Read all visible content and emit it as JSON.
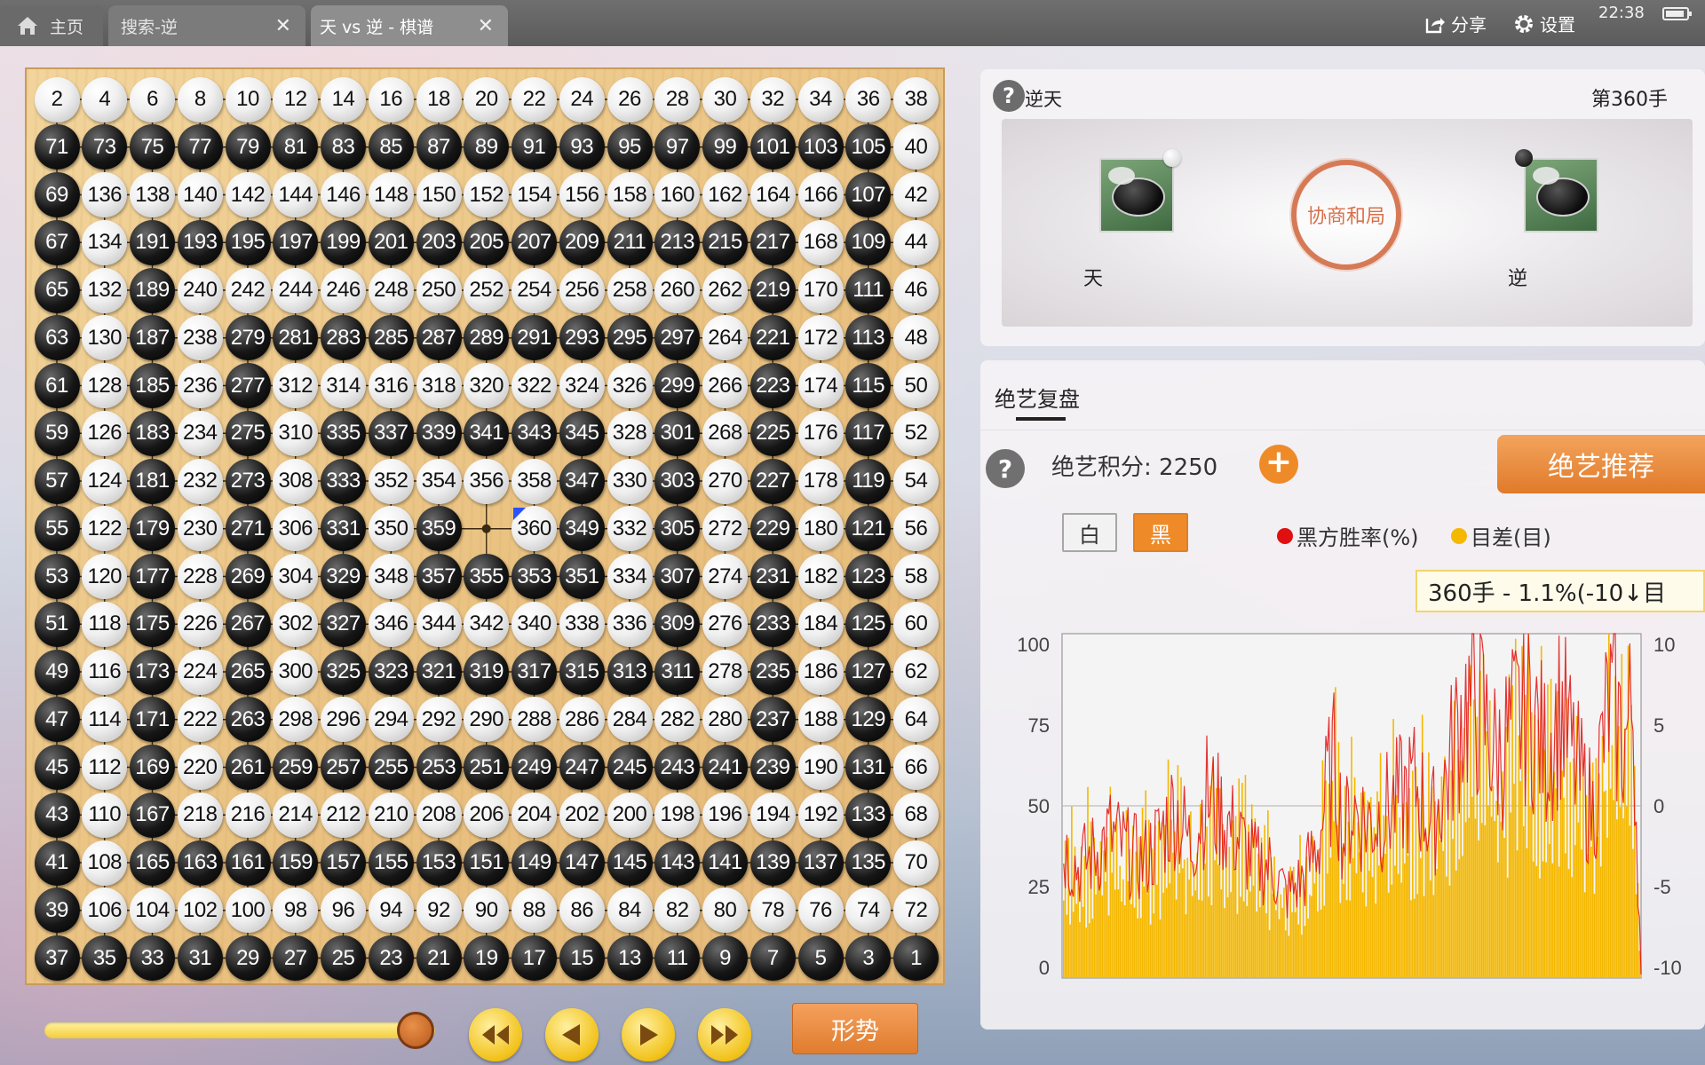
{
  "tabs": [
    {
      "label": "主页"
    },
    {
      "label": "搜索-逆"
    },
    {
      "label": "天 vs 逆 - 棋谱"
    }
  ],
  "toolbar": {
    "share": "分享",
    "settings": "设置"
  },
  "status": {
    "time": "22:38"
  },
  "game": {
    "rule": "逆天",
    "move_no": "第360手",
    "result_seal": "协商和局",
    "players": {
      "white": "天",
      "black": "逆"
    },
    "last_move": 360,
    "board": [
      [
        2,
        4,
        6,
        8,
        10,
        12,
        14,
        16,
        18,
        20,
        22,
        24,
        26,
        28,
        30,
        32,
        34,
        36,
        38
      ],
      [
        71,
        73,
        75,
        77,
        79,
        81,
        83,
        85,
        87,
        89,
        91,
        93,
        95,
        97,
        99,
        101,
        103,
        105,
        40
      ],
      [
        69,
        136,
        138,
        140,
        142,
        144,
        146,
        148,
        150,
        152,
        154,
        156,
        158,
        160,
        162,
        164,
        166,
        107,
        42
      ],
      [
        67,
        134,
        191,
        193,
        195,
        197,
        199,
        201,
        203,
        205,
        207,
        209,
        211,
        213,
        215,
        217,
        168,
        109,
        44
      ],
      [
        65,
        132,
        189,
        240,
        242,
        244,
        246,
        248,
        250,
        252,
        254,
        256,
        258,
        260,
        262,
        219,
        170,
        111,
        46
      ],
      [
        63,
        130,
        187,
        238,
        279,
        281,
        283,
        285,
        287,
        289,
        291,
        293,
        295,
        297,
        264,
        221,
        172,
        113,
        48
      ],
      [
        61,
        128,
        185,
        236,
        277,
        312,
        314,
        316,
        318,
        320,
        322,
        324,
        326,
        299,
        266,
        223,
        174,
        115,
        50
      ],
      [
        59,
        126,
        183,
        234,
        275,
        310,
        335,
        337,
        339,
        341,
        343,
        345,
        328,
        301,
        268,
        225,
        176,
        117,
        52
      ],
      [
        57,
        124,
        181,
        232,
        273,
        308,
        333,
        352,
        354,
        356,
        358,
        347,
        330,
        303,
        270,
        227,
        178,
        119,
        54
      ],
      [
        55,
        122,
        179,
        230,
        271,
        306,
        331,
        350,
        359,
        null,
        360,
        349,
        332,
        305,
        272,
        229,
        180,
        121,
        56
      ],
      [
        53,
        120,
        177,
        228,
        269,
        304,
        329,
        348,
        357,
        355,
        353,
        351,
        334,
        307,
        274,
        231,
        182,
        123,
        58
      ],
      [
        51,
        118,
        175,
        226,
        267,
        302,
        327,
        346,
        344,
        342,
        340,
        338,
        336,
        309,
        276,
        233,
        184,
        125,
        60
      ],
      [
        49,
        116,
        173,
        224,
        265,
        300,
        325,
        323,
        321,
        319,
        317,
        315,
        313,
        311,
        278,
        235,
        186,
        127,
        62
      ],
      [
        47,
        114,
        171,
        222,
        263,
        298,
        296,
        294,
        292,
        290,
        288,
        286,
        284,
        282,
        280,
        237,
        188,
        129,
        64
      ],
      [
        45,
        112,
        169,
        220,
        261,
        259,
        257,
        255,
        253,
        251,
        249,
        247,
        245,
        243,
        241,
        239,
        190,
        131,
        66
      ],
      [
        43,
        110,
        167,
        218,
        216,
        214,
        212,
        210,
        208,
        206,
        204,
        202,
        200,
        198,
        196,
        194,
        192,
        133,
        68
      ],
      [
        41,
        108,
        165,
        163,
        161,
        159,
        157,
        155,
        153,
        151,
        149,
        147,
        145,
        143,
        141,
        139,
        137,
        135,
        70
      ],
      [
        39,
        106,
        104,
        102,
        100,
        98,
        96,
        94,
        92,
        90,
        88,
        86,
        84,
        82,
        80,
        78,
        76,
        74,
        72
      ],
      [
        37,
        35,
        33,
        31,
        29,
        27,
        25,
        23,
        21,
        19,
        17,
        15,
        13,
        11,
        9,
        7,
        5,
        3,
        1
      ]
    ]
  },
  "controls": {
    "position_label": "形势",
    "slider_progress": 0.95
  },
  "review": {
    "tab_label": "绝艺复盘",
    "score_label": "绝艺积分: 2250",
    "recommend_label": "绝艺推荐",
    "side_white": "白",
    "side_black": "黑",
    "legend_winrate": "黑方胜率(%)",
    "legend_diff": "目差(目)",
    "tooltip": "360手 - 1.1%(-10↓目"
  },
  "colors": {
    "accent": "#ef8a28",
    "winrate": "#e01010",
    "diff": "#f5b800"
  },
  "chart_data": {
    "type": "line",
    "moves": 360,
    "left_axis": {
      "ticks": [
        "100",
        "75",
        "50",
        "25",
        "0"
      ],
      "range": [
        0,
        100
      ]
    },
    "right_axis": {
      "ticks": [
        "10",
        "5",
        "0",
        "-5",
        "-10"
      ],
      "range": [
        -10,
        10
      ]
    },
    "series": [
      {
        "name": "黑方胜率(%)",
        "color": "#e01010"
      },
      {
        "name": "目差(目)",
        "color": "#f5b800"
      }
    ],
    "envelope": [
      [
        0,
        48
      ],
      [
        10,
        40
      ],
      [
        20,
        45
      ],
      [
        30,
        52
      ],
      [
        40,
        46
      ],
      [
        50,
        42
      ],
      [
        60,
        50
      ],
      [
        70,
        62
      ],
      [
        80,
        48
      ],
      [
        90,
        66
      ],
      [
        100,
        58
      ],
      [
        110,
        50
      ],
      [
        120,
        42
      ],
      [
        130,
        40
      ],
      [
        140,
        30
      ],
      [
        150,
        36
      ],
      [
        160,
        50
      ],
      [
        165,
        70
      ],
      [
        170,
        78
      ],
      [
        175,
        50
      ],
      [
        180,
        62
      ],
      [
        190,
        56
      ],
      [
        200,
        60
      ],
      [
        210,
        65
      ],
      [
        220,
        70
      ],
      [
        230,
        55
      ],
      [
        240,
        75
      ],
      [
        250,
        100
      ],
      [
        260,
        98
      ],
      [
        270,
        80
      ],
      [
        280,
        90
      ],
      [
        290,
        100
      ],
      [
        300,
        82
      ],
      [
        310,
        98
      ],
      [
        320,
        75
      ],
      [
        330,
        60
      ],
      [
        340,
        100
      ],
      [
        350,
        85
      ],
      [
        355,
        100
      ],
      [
        360,
        1.1
      ]
    ]
  }
}
